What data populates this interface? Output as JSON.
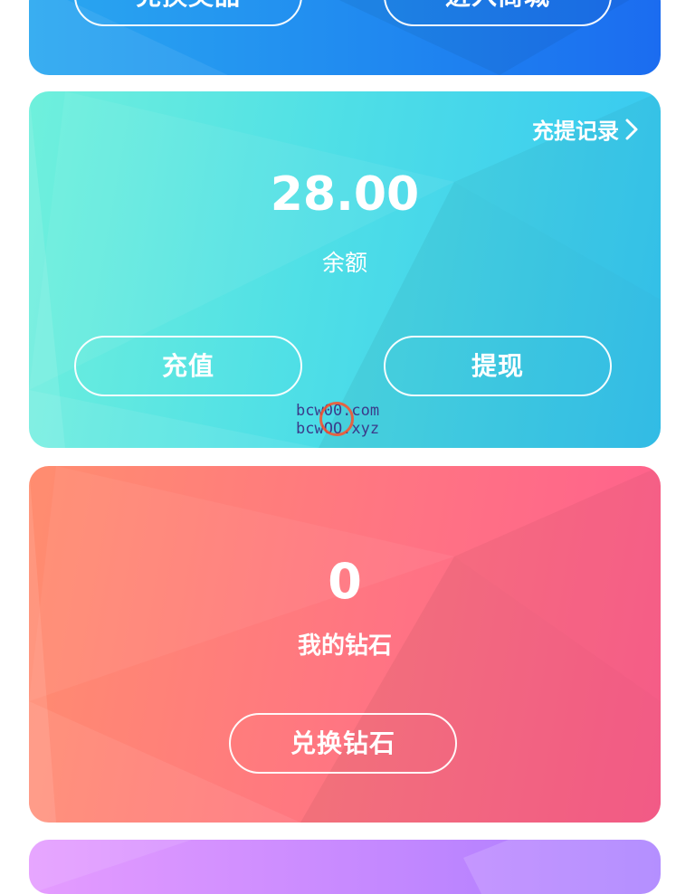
{
  "top_card": {
    "left_button": "兑换奖品",
    "right_button": "进入商城"
  },
  "balance_card": {
    "record_link": "充提记录",
    "amount": "28.00",
    "label": "余额",
    "recharge_button": "充值",
    "withdraw_button": "提现"
  },
  "diamond_card": {
    "amount": "0",
    "label": "我的钻石",
    "exchange_button": "兑换钻石"
  },
  "watermark": {
    "line1": "bcw00.com",
    "line2": "bcwOO.xyz"
  },
  "icons": {
    "record_link_icon": "chevron-right-icon"
  },
  "colors": {
    "blue_card": "#1f86f0",
    "cyan_card": "#4fdfe6",
    "pink_card": "#ff7483",
    "purple_card": "#c88aff"
  }
}
